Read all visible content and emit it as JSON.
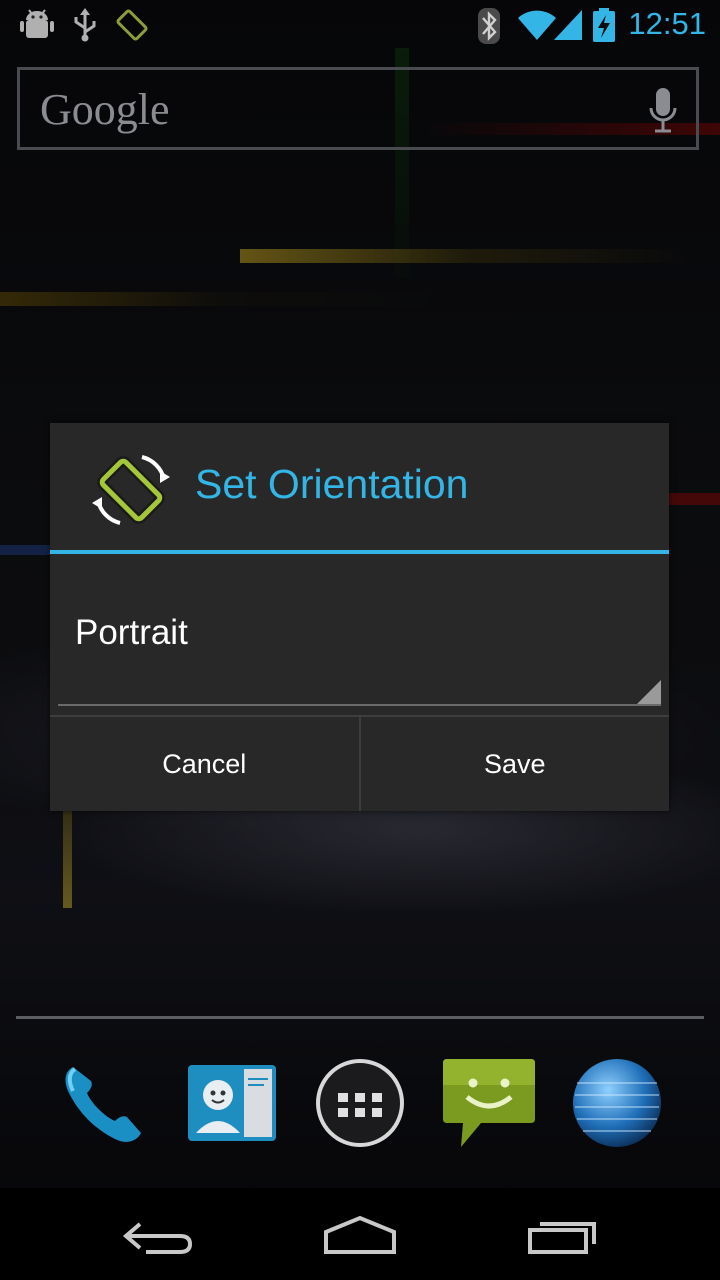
{
  "status_bar": {
    "time": "12:51",
    "left_icons": [
      "android-debug-icon",
      "usb-icon",
      "screen-rotation-icon"
    ],
    "right_icons": [
      "bluetooth-icon",
      "wifi-icon",
      "cell-signal-icon",
      "battery-charging-icon"
    ]
  },
  "search_widget": {
    "logo_text": "Google",
    "mic_icon": "microphone-icon"
  },
  "dialog": {
    "icon": "screen-rotation-icon",
    "title": "Set Orientation",
    "selected_value": "Portrait",
    "buttons": {
      "cancel": "Cancel",
      "save": "Save"
    }
  },
  "dock": {
    "items": [
      "phone-icon",
      "contacts-icon",
      "all-apps-icon",
      "messaging-icon",
      "browser-icon"
    ]
  },
  "navigation": {
    "buttons": [
      "back-icon",
      "home-icon",
      "recent-apps-icon"
    ]
  },
  "colors": {
    "accent": "#33b5e5",
    "dialog_background": "#282828",
    "rotation_icon_green": "#a4c639"
  }
}
